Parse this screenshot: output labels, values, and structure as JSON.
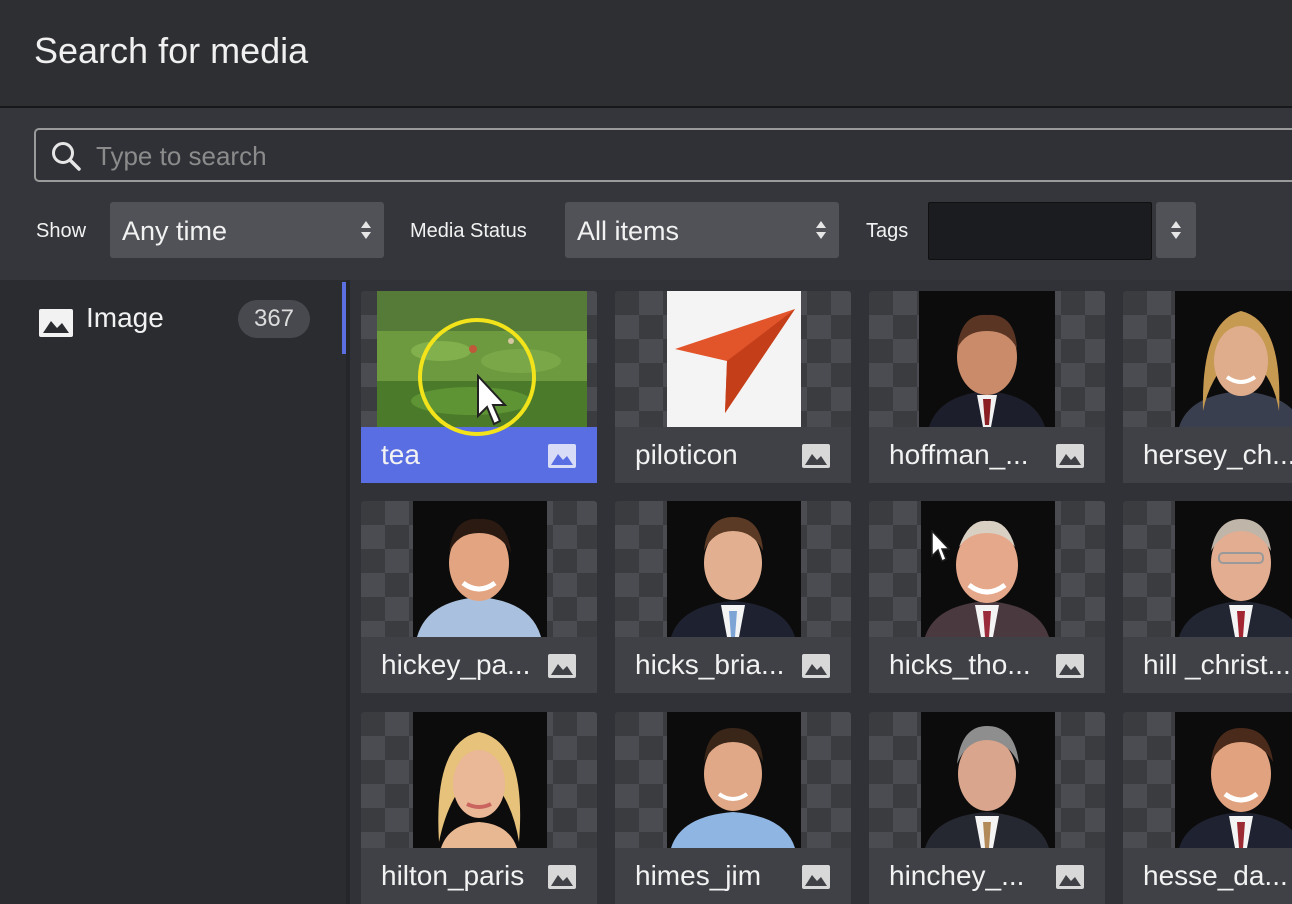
{
  "title": "Search for media",
  "search": {
    "placeholder": "Type to search",
    "value": ""
  },
  "filters": {
    "show_label": "Show",
    "show_value": "Any time",
    "status_label": "Media Status",
    "status_value": "All items",
    "tags_label": "Tags",
    "tags_value": ""
  },
  "sidebar": {
    "items": [
      {
        "label": "Image",
        "count": "367",
        "icon": "image-icon"
      }
    ]
  },
  "colors": {
    "accent": "#5a6ee3",
    "highlight": "#f2e31a",
    "background": "#2f3136"
  },
  "media": [
    {
      "name": "tea",
      "kind": "photo-landscape",
      "selected": true
    },
    {
      "name": "piloticon",
      "kind": "logo"
    },
    {
      "name": "hoffman_...",
      "kind": "portrait"
    },
    {
      "name": "hersey_ch...",
      "kind": "portrait"
    },
    {
      "name": "hickey_pa...",
      "kind": "portrait"
    },
    {
      "name": "hicks_bria...",
      "kind": "portrait"
    },
    {
      "name": "hicks_tho...",
      "kind": "portrait"
    },
    {
      "name": "hill _christ...",
      "kind": "portrait"
    },
    {
      "name": "hilton_paris",
      "kind": "portrait"
    },
    {
      "name": "himes_jim",
      "kind": "portrait"
    },
    {
      "name": "hinchey_...",
      "kind": "portrait"
    },
    {
      "name": "hesse_da...",
      "kind": "portrait"
    }
  ]
}
